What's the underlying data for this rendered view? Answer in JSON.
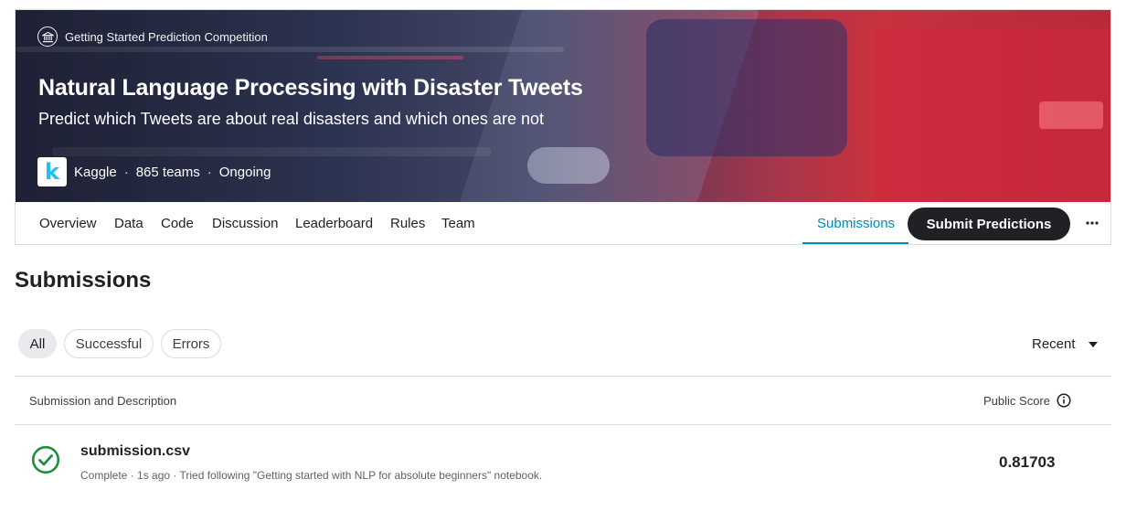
{
  "competition": {
    "type_label": "Getting Started Prediction Competition",
    "title": "Natural Language Processing with Disaster Tweets",
    "subtitle": "Predict which Tweets are about real disasters and which ones are not",
    "host_logo_letter": "k",
    "host": "Kaggle",
    "teams": "865 teams",
    "status": "Ongoing",
    "separator": "·"
  },
  "tabs": {
    "overview": "Overview",
    "data": "Data",
    "code": "Code",
    "discussion": "Discussion",
    "leaderboard": "Leaderboard",
    "rules": "Rules",
    "team": "Team",
    "submissions": "Submissions",
    "active": "Submissions"
  },
  "actions": {
    "submit_label": "Submit Predictions",
    "more_icon": "more-horizontal-icon"
  },
  "submissions": {
    "heading": "Submissions",
    "filters": [
      "All",
      "Successful",
      "Errors"
    ],
    "selected_filter": "All",
    "sort_label": "Recent",
    "columns": {
      "description": "Submission and Description",
      "score": "Public Score"
    },
    "rows": [
      {
        "file": "submission.csv",
        "meta": "Complete · 1s ago · Tried following \"Getting started with NLP for absolute beginners\" notebook.",
        "score": "0.81703",
        "status_icon": "check-circle-icon"
      }
    ]
  },
  "colors": {
    "accent": "#008abc",
    "success": "#1e8e3e",
    "dark_button": "#202124",
    "kaggle_blue": "#20beff"
  }
}
